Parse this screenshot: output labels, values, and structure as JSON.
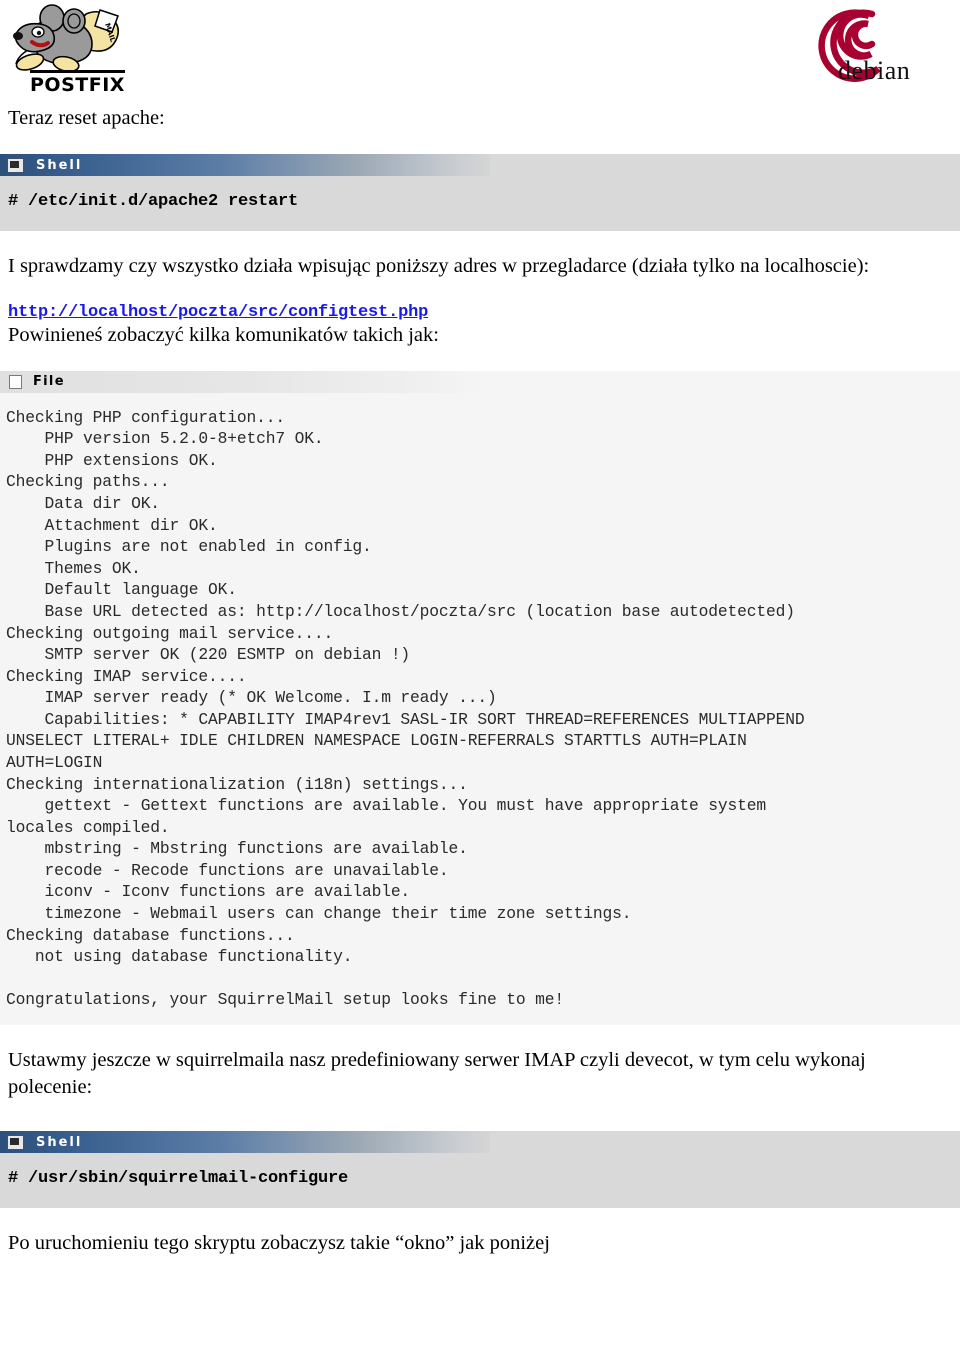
{
  "header": {
    "postfix_logo_label": "POSTFIX",
    "debian_logo_label": "debian"
  },
  "content": {
    "intro_line": "Teraz reset apache:",
    "instruction_line": "I sprawdzamy czy wszystko działa wpisując poniższy adres w przegladarce (działa tylko na localhoscie):",
    "config_url": "http://localhost/poczta/src/configtest.php",
    "expect_line": "Powinieneś zobaczyć kilka komunikatów takich jak:",
    "imap_setup_line": "Ustawmy jeszcze w squirrelmaila nasz predefiniowany serwer IMAP czyli devecot, w tym celu wykonaj polecenie:",
    "closing_line": "Po uruchomieniu tego skryptu zobaczysz takie “okno”  jak poniżej"
  },
  "shell_block_1": {
    "title": "Shell",
    "icon": "terminal-icon",
    "command": "# /etc/init.d/apache2 restart"
  },
  "shell_block_2": {
    "title": "Shell",
    "icon": "terminal-icon",
    "command": "# /usr/sbin/squirrelmail-configure"
  },
  "file_block": {
    "title": "File",
    "icon": "document-icon",
    "output": "Checking PHP configuration...\n    PHP version 5.2.0-8+etch7 OK.\n    PHP extensions OK.\nChecking paths...\n    Data dir OK.\n    Attachment dir OK.\n    Plugins are not enabled in config.\n    Themes OK.\n    Default language OK.\n    Base URL detected as: http://localhost/poczta/src (location base autodetected)\nChecking outgoing mail service....\n    SMTP server OK (220 ESMTP on debian !)\nChecking IMAP service....\n    IMAP server ready (* OK Welcome. I.m ready ...)\n    Capabilities: * CAPABILITY IMAP4rev1 SASL-IR SORT THREAD=REFERENCES MULTIAPPEND\nUNSELECT LITERAL+ IDLE CHILDREN NAMESPACE LOGIN-REFERRALS STARTTLS AUTH=PLAIN\nAUTH=LOGIN\nChecking internationalization (i18n) settings...\n    gettext - Gettext functions are available. You must have appropriate system\nlocales compiled.\n    mbstring - Mbstring functions are available.\n    recode - Recode functions are unavailable.\n    iconv - Iconv functions are available.\n    timezone - Webmail users can change their time zone settings.\nChecking database functions...\n   not using database functionality.\n\nCongratulations, your SquirrelMail setup looks fine to me!"
  },
  "colors": {
    "link": "#1a1ae6",
    "shell_titlebar_start": "#2d4f7c",
    "shell_body_bg": "#d9d9d9",
    "file_body_bg": "#f5f5f5",
    "debian_red": "#a80030"
  }
}
